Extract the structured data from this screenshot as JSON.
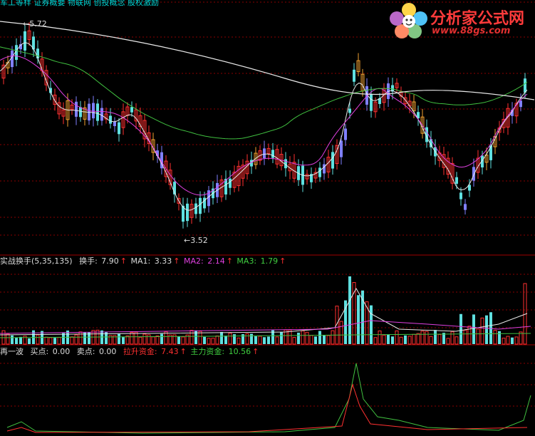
{
  "top_text": "军工等样 证券概要 物联网 创投概念 股权激励",
  "logo": {
    "title": "分析家公式网",
    "url": "www.88gs.com"
  },
  "price_labels": {
    "high": "5.72",
    "low": "3.52"
  },
  "panel2": {
    "name": "实战换手(5,35,135)",
    "items": [
      {
        "label": "换手:",
        "value": "7.90",
        "color": "#dcdcdc"
      },
      {
        "label": "MA1:",
        "value": "3.33",
        "color": "#dcdcdc"
      },
      {
        "label": "MA2:",
        "value": "2.14",
        "color": "#e040e0"
      },
      {
        "label": "MA3:",
        "value": "1.79",
        "color": "#40d040"
      }
    ]
  },
  "panel3": {
    "items": [
      {
        "label": "再一波",
        "value": "",
        "color": "#dcdcdc"
      },
      {
        "label": "买点:",
        "value": "0.00",
        "color": "#dcdcdc"
      },
      {
        "label": "卖点:",
        "value": "0.00",
        "color": "#dcdcdc"
      },
      {
        "label": "拉升资金:",
        "value": "7.43",
        "color": "#ff3030"
      },
      {
        "label": "主力资金:",
        "value": "10.56",
        "color": "#40d040"
      }
    ]
  },
  "colors": {
    "up": "#ff3030",
    "down": "#5fe0e0",
    "grid": "#8a0000",
    "ma_white": "#e8e8e8",
    "ma_magenta": "#e040e0",
    "ma_green": "#40c040",
    "ma_orange": "#f0a030",
    "ma_purple": "#8080ff"
  }
}
